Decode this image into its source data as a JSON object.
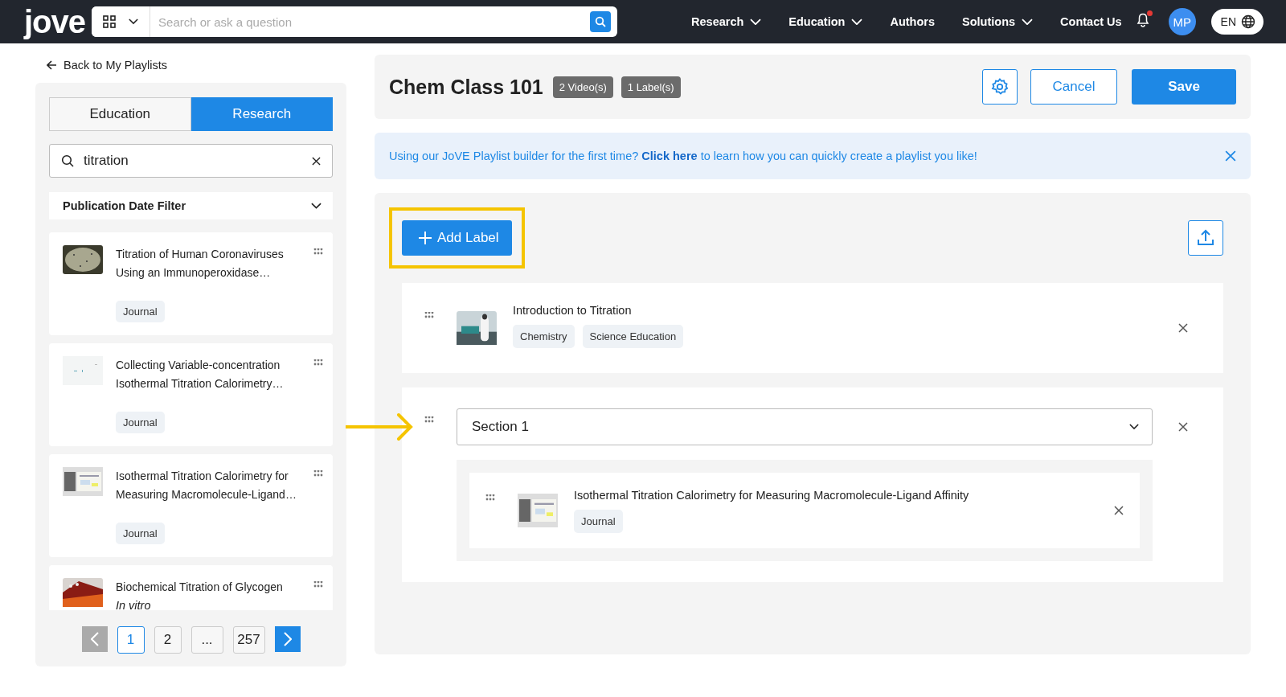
{
  "header": {
    "logo": "jove",
    "search": {
      "placeholder": "Search or ask a question"
    },
    "nav": [
      {
        "label": "Research",
        "dropdown": true
      },
      {
        "label": "Education",
        "dropdown": true
      },
      {
        "label": "Authors",
        "dropdown": false
      },
      {
        "label": "Solutions",
        "dropdown": true
      },
      {
        "label": "Contact Us",
        "dropdown": false
      }
    ],
    "notifications_unread": true,
    "avatar": "MP",
    "language": "EN"
  },
  "back_link": "Back to My Playlists",
  "sidebar": {
    "tabs": [
      {
        "label": "Education",
        "selected": false
      },
      {
        "label": "Research",
        "selected": true
      }
    ],
    "search": {
      "value": "titration"
    },
    "filter": "Publication Date Filter",
    "results": [
      {
        "title": "Titration of Human Coronaviruses Using an Immunoperoxidase…",
        "tag": "Journal"
      },
      {
        "title": "Collecting Variable-concentration Isothermal Titration Calorimetry…",
        "tag": "Journal"
      },
      {
        "title": "Isothermal Titration Calorimetry for Measuring Macromolecule-Ligand…",
        "tag": "Journal"
      },
      {
        "title": "Biochemical Titration of Glycogen",
        "subtitle": "In vitro"
      }
    ],
    "pagination": {
      "prev_disabled": true,
      "next_disabled": false,
      "pages": [
        {
          "label": "1",
          "selected": true
        },
        {
          "label": "2",
          "selected": false
        },
        {
          "label": "...",
          "selected": false
        },
        {
          "label": "257",
          "selected": false
        }
      ]
    }
  },
  "playlist": {
    "title": "Chem Class 101",
    "badges": [
      "2 Video(s)",
      "1 Label(s)"
    ],
    "cancel": "Cancel",
    "save": "Save",
    "banner": {
      "before": "Using our JoVE Playlist builder for the first time? ",
      "link": "Click here",
      "after": " to learn how you can quickly create a playlist you like!"
    },
    "add_label": "Add Label",
    "items": [
      {
        "kind": "video",
        "title": "Introduction to Titration",
        "tags": [
          "Chemistry",
          "Science Education"
        ]
      },
      {
        "kind": "section",
        "label": "Section 1",
        "children": [
          {
            "kind": "video",
            "title": "Isothermal Titration Calorimetry for Measuring Macromolecule-Ligand Affinity",
            "tags": [
              "Journal"
            ]
          }
        ]
      }
    ]
  }
}
